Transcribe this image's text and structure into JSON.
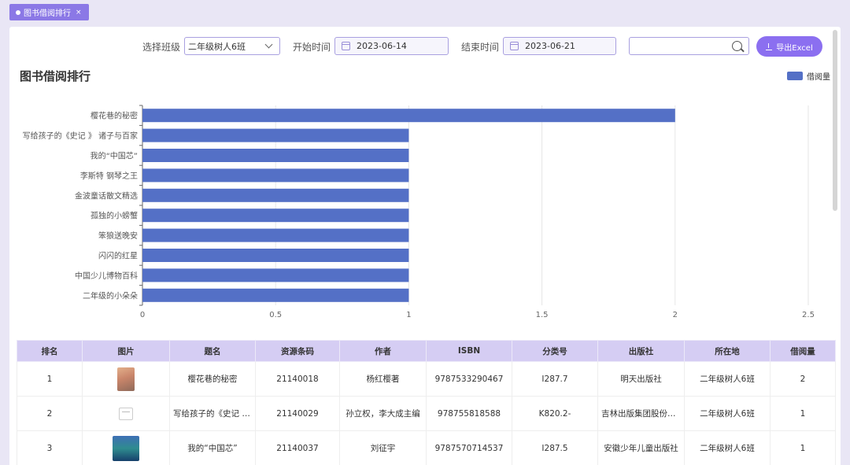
{
  "tab": {
    "label": "图书借阅排行",
    "close": "×"
  },
  "filters": {
    "class_label": "选择班级",
    "class_value": "二年级树人6班",
    "start_label": "开始时间",
    "start_value": "2023-06-14",
    "end_label": "结束时间",
    "end_value": "2023-06-21",
    "search_value": "",
    "export_label": "导出Excel"
  },
  "page_title": "图书借阅排行",
  "chart_data": {
    "type": "bar",
    "orientation": "horizontal",
    "title": "",
    "categories": [
      "樱花巷的秘密",
      "写给孩子的《史记 》 诸子与百家",
      "我的“中国芯”",
      "李斯特 钢琴之王",
      "金波童话散文精选",
      "孤独的小螃蟹",
      "笨狼送晚安",
      "闪闪的红星",
      "中国少儿博物百科",
      "二年级的小朵朵"
    ],
    "series": [
      {
        "name": "借阅量",
        "values": [
          2,
          1,
          1,
          1,
          1,
          1,
          1,
          1,
          1,
          1
        ]
      }
    ],
    "xlim": [
      0,
      2.5
    ],
    "xticks": [
      "0",
      "0.5",
      "1",
      "1.5",
      "2",
      "2.5"
    ],
    "grid": true,
    "legend_position": "top-right",
    "bar_color": "#5470c6"
  },
  "table": {
    "headers": [
      "排名",
      "图片",
      "题名",
      "资源条码",
      "作者",
      "ISBN",
      "分类号",
      "出版社",
      "所在地",
      "借阅量"
    ],
    "rows": [
      {
        "rank": "1",
        "thumb": "t1",
        "title": "樱花巷的秘密",
        "barcode": "21140018",
        "author": "杨红樱著",
        "isbn": "9787533290467",
        "class_no": "I287.7",
        "publisher": "明天出版社",
        "location": "二年级树人6班",
        "count": "2"
      },
      {
        "rank": "2",
        "thumb": "t2",
        "title": "写给孩子的《史记 》...",
        "barcode": "21140029",
        "author": "孙立权，李大成主编",
        "isbn": "978755818588",
        "class_no": "K820.2-",
        "publisher": "吉林出版集团股份有...",
        "location": "二年级树人6班",
        "count": "1"
      },
      {
        "rank": "3",
        "thumb": "t3",
        "title": "我的“中国芯”",
        "barcode": "21140037",
        "author": "刘征宇",
        "isbn": "9787570714537",
        "class_no": "I287.5",
        "publisher": "安徽少年儿童出版社",
        "location": "二年级树人6班",
        "count": "1"
      }
    ]
  }
}
